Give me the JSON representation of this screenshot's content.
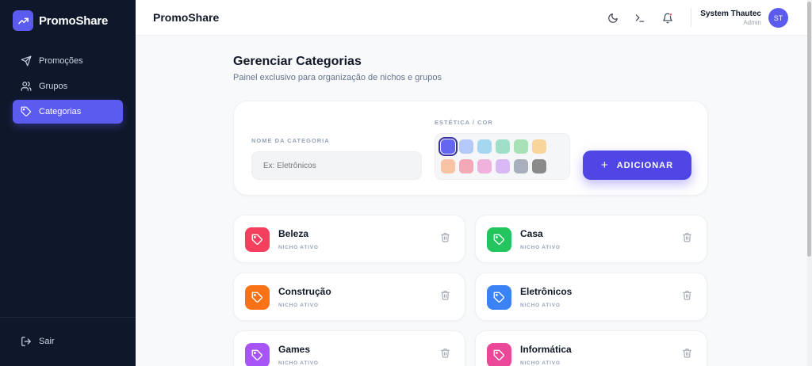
{
  "app": {
    "name": "PromoShare"
  },
  "sidebar": {
    "items": [
      {
        "label": "Promoções",
        "icon": "send-icon",
        "active": false
      },
      {
        "label": "Grupos",
        "icon": "users-icon",
        "active": false
      },
      {
        "label": "Categorias",
        "icon": "tag-icon",
        "active": true
      }
    ],
    "logout_label": "Sair"
  },
  "header": {
    "title": "PromoShare",
    "icons": [
      "moon-icon",
      "terminal-icon",
      "bell-icon"
    ],
    "user": {
      "name": "System Thautec",
      "role": "Admin",
      "initials": "ST"
    }
  },
  "main": {
    "title": "Gerenciar Categorias",
    "subtitle": "Painel exclusivo para organização de nichos e grupos"
  },
  "form": {
    "name_label": "NOME DA CATEGORIA",
    "name_placeholder": "Ex: Eletrônicos",
    "color_label": "ESTÉTICA / COR",
    "colors": [
      "#6366f1",
      "#b4c9f8",
      "#a5d8f0",
      "#9fdfc8",
      "#a8e2b4",
      "#f7d59b",
      "#f9c3a4",
      "#f4a9b8",
      "#f0b2dc",
      "#d8b9f5",
      "#a9b0bb",
      "#8a8a8a"
    ],
    "selected_color": "#6366f1",
    "submit_label": "ADICIONAR"
  },
  "categories": [
    {
      "name": "Beleza",
      "status": "NICHO ATIVO",
      "color": "#f43f5e"
    },
    {
      "name": "Casa",
      "status": "NICHO ATIVO",
      "color": "#22c55e"
    },
    {
      "name": "Construção",
      "status": "NICHO ATIVO",
      "color": "#f97316"
    },
    {
      "name": "Eletrônicos",
      "status": "NICHO ATIVO",
      "color": "#3b82f6"
    },
    {
      "name": "Games",
      "status": "NICHO ATIVO",
      "color": "#a855f7"
    },
    {
      "name": "Informática",
      "status": "NICHO ATIVO",
      "color": "#ec4899"
    }
  ],
  "colors": {
    "accent": "#5b5bf0",
    "sidebar_bg": "#0f172a"
  }
}
